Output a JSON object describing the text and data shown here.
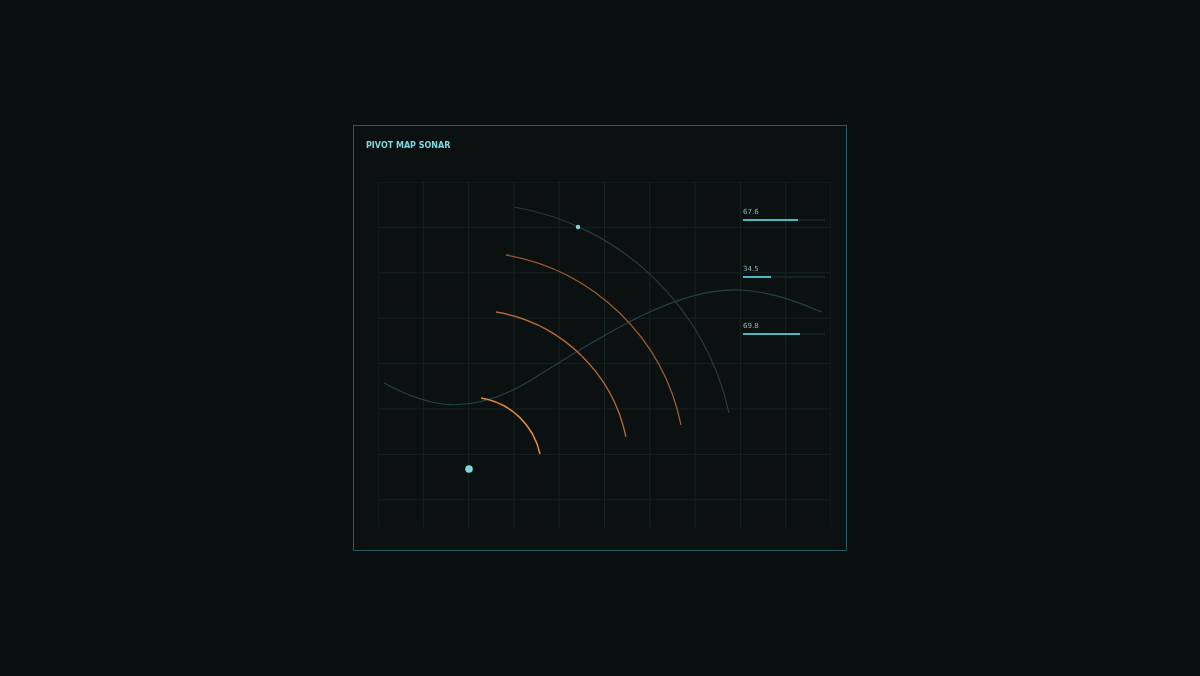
{
  "panel": {
    "title": "PIVOT MAP SONAR"
  },
  "meters": [
    {
      "reading": "67.6",
      "level": 0.676
    },
    {
      "reading": "34.5",
      "level": 0.345
    },
    {
      "reading": "69.8",
      "level": 0.698
    }
  ]
}
